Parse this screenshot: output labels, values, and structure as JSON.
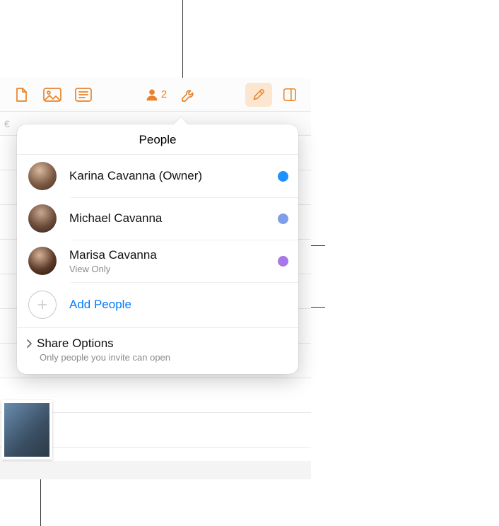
{
  "toolbar": {
    "accent_color": "#E8832B",
    "people_count": "2",
    "icons": {
      "document": "document-icon",
      "media": "media-icon",
      "list": "list-icon",
      "collaboration": "collaboration-icon",
      "tools": "tools-icon",
      "format": "format-icon",
      "panel": "panel-icon"
    }
  },
  "popover": {
    "title": "People",
    "people": [
      {
        "name": "Karina Cavanna (Owner)",
        "sub": "",
        "dot_color": "#1E90FF"
      },
      {
        "name": "Michael Cavanna",
        "sub": "",
        "dot_color": "#7E9FE8"
      },
      {
        "name": "Marisa Cavanna",
        "sub": "View Only",
        "dot_color": "#A878E8"
      }
    ],
    "add_people_label": "Add People",
    "share_options": {
      "title": "Share Options",
      "subtitle": "Only people you invite can open"
    }
  }
}
